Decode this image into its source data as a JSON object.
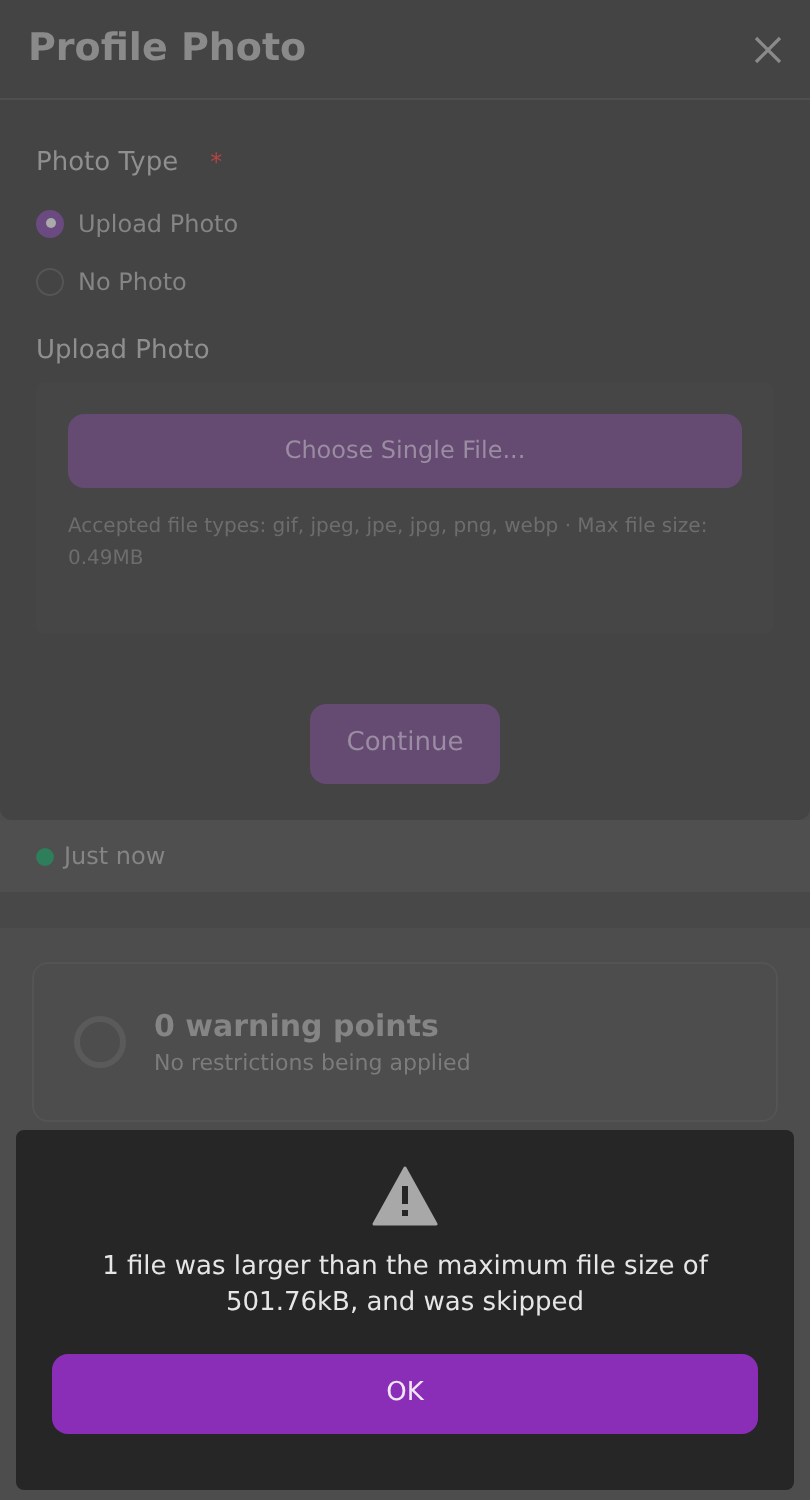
{
  "modal": {
    "title": "Profile Photo",
    "photo_type": {
      "label": "Photo Type",
      "required_mark": "*",
      "options": [
        {
          "label": "Upload Photo",
          "selected": true
        },
        {
          "label": "No Photo",
          "selected": false
        }
      ]
    },
    "upload": {
      "label": "Upload Photo",
      "button": "Choose Single File...",
      "help": "Accepted file types: gif, jpeg, jpe, jpg, png, webp · Max file size: 0.49MB"
    },
    "continue_button": "Continue"
  },
  "background": {
    "status": {
      "text": "Just now",
      "color": "#2e7d5b"
    },
    "warning_card": {
      "title": "0 warning points",
      "subtitle": "No restrictions being applied"
    }
  },
  "alert": {
    "message": "1 file was larger than the maximum file size of 501.76kB, and was skipped",
    "button": "OK"
  }
}
